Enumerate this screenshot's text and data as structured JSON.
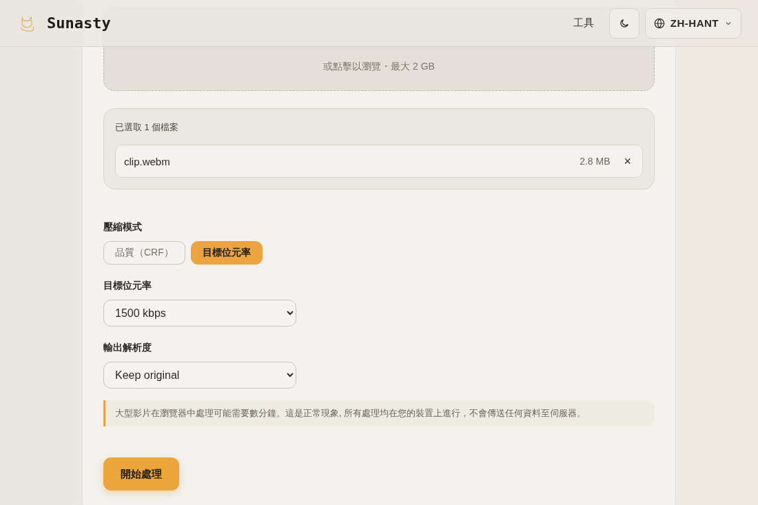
{
  "header": {
    "brand": "Sunasty",
    "nav_link": "工具",
    "language": "ZH-HANT"
  },
  "dropzone": {
    "hint": "或點擊以瀏覽・最大 2 GB"
  },
  "selected_files": {
    "title": "已選取 1 個檔案",
    "files": [
      {
        "name": "clip.webm",
        "size": "2.8 MB",
        "remove": "×"
      }
    ]
  },
  "compression_mode": {
    "label": "壓縮模式",
    "options": [
      {
        "label": "品質（CRF）",
        "selected": false
      },
      {
        "label": "目標位元率",
        "selected": true
      }
    ]
  },
  "fields": [
    {
      "label": "目標位元率",
      "value": "1500 kbps"
    },
    {
      "label": "輸出解析度",
      "value": "Keep original"
    }
  ],
  "notice": "大型影片在瀏覽器中處理可能需要數分鐘。這是正常現象, 所有處理均在您的裝置上進行，不會傳送任何資料至伺服器。",
  "start_button": "開始處理"
}
